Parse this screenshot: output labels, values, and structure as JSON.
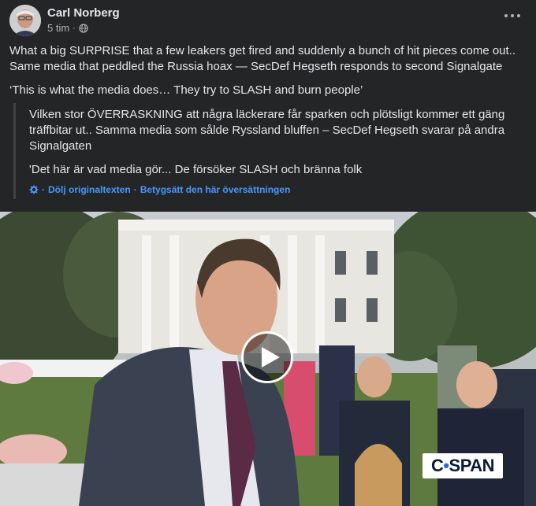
{
  "post": {
    "author": "Carl Norberg",
    "time": "5 tim",
    "separator": "·",
    "text_p1": "What a big SURPRISE that a few leakers get fired and suddenly a bunch of hit pieces come out.. Same media that peddled the Russia hoax — SecDef Hegseth responds to second Signalgate",
    "text_p2": "‘This is what the media does… They try to SLASH and burn people’"
  },
  "translation": {
    "p1": "Vilken stor ÖVERRASKNING att några läckerare får sparken och plötsligt kommer ett gäng träffbitar ut.. Samma media som sålde Ryssland bluffen – SecDef Hegseth svarar på andra Signalgaten",
    "p2": "'Det här är vad media gör... De försöker SLASH och bränna folk",
    "hide_link": "Dölj originaltexten",
    "rate_link": "Betygsätt den här översättningen",
    "sep": "·"
  },
  "video": {
    "watermark_part1": "C",
    "watermark_dot": "•",
    "watermark_part2": "SPAN"
  },
  "icons": {
    "more": "more-options-icon",
    "globe": "globe-icon",
    "gear": "gear-icon",
    "play": "play-icon"
  },
  "colors": {
    "background": "#242526",
    "text": "#e4e6eb",
    "secondary": "#b0b3b8",
    "link": "#4599ff"
  }
}
